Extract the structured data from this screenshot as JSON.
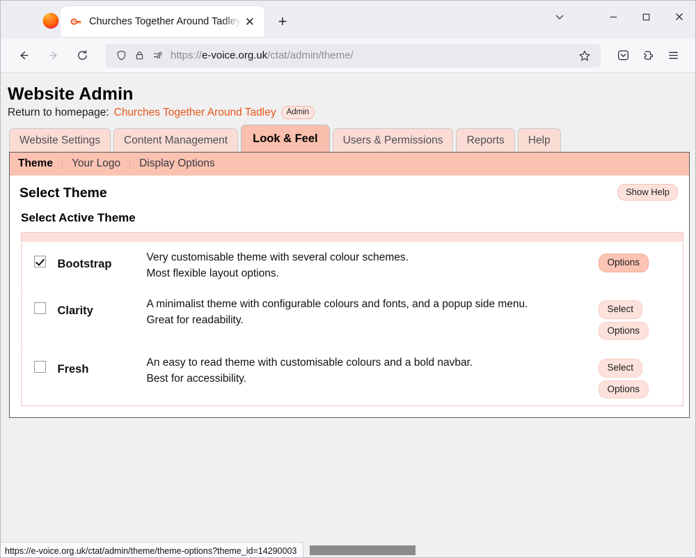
{
  "browser": {
    "tab": {
      "title": "Churches Together Around Tadley",
      "favicon_name": "key-icon",
      "close_label": "✕"
    },
    "newtab_label": "+",
    "window_controls": {
      "list_all_tabs": "⌄",
      "minimize": "—",
      "maximize": "▢",
      "close": "✕"
    },
    "nav": {
      "back": "←",
      "forward": "→",
      "reload": "⟳"
    },
    "urlbar": {
      "scheme": "https://",
      "host": "e-voice.org.uk",
      "path": "/ctat/admin/theme/",
      "full_url": "https://e-voice.org.uk/ctat/admin/theme/",
      "shield_icon": "tracking-protection-shield-icon",
      "lock_icon": "padlock-icon",
      "permissions_icon": "site-permissions-icon",
      "bookmark_icon": "star-icon"
    },
    "toolbar_trailing": {
      "pocket": "save-to-pocket-icon",
      "extensions": "extensions-icon",
      "app_menu": "hamburger-menu-icon"
    },
    "statusbar": {
      "link_preview": "https://e-voice.org.uk/ctat/admin/theme/theme-options?theme_id=14290003"
    }
  },
  "page": {
    "title": "Website Admin",
    "return_label": "Return to homepage:",
    "site_link": "Churches Together Around Tadley",
    "role_badge": "Admin",
    "main_tabs": [
      {
        "label": "Website Settings",
        "active": false
      },
      {
        "label": "Content Management",
        "active": false
      },
      {
        "label": "Look & Feel",
        "active": true
      },
      {
        "label": "Users & Permissions",
        "active": false
      },
      {
        "label": "Reports",
        "active": false
      },
      {
        "label": "Help",
        "active": false
      }
    ],
    "sub_tabs": [
      {
        "label": "Theme",
        "active": true
      },
      {
        "label": "Your Logo",
        "active": false
      },
      {
        "label": "Display Options",
        "active": false
      }
    ],
    "panel": {
      "heading": "Select Theme",
      "show_help": "Show Help",
      "section_heading": "Select Active Theme",
      "themes": [
        {
          "name": "Bootstrap",
          "checked": true,
          "desc": "Very customisable theme with several colour schemes.",
          "tagline": "Most flexible layout options.",
          "select_label": null,
          "options_label": "Options",
          "options_hot": true
        },
        {
          "name": "Clarity",
          "checked": false,
          "desc": "A minimalist theme with configurable colours and fonts, and a popup side menu.",
          "tagline": "Great for readability.",
          "select_label": "Select",
          "options_label": "Options",
          "options_hot": false
        },
        {
          "name": "Fresh",
          "checked": false,
          "desc": "An easy to read theme with customisable colours and a bold navbar.",
          "tagline": "Best for accessibility.",
          "select_label": "Select",
          "options_label": "Options",
          "options_hot": false
        }
      ]
    }
  },
  "colors": {
    "accent_orange": "#e8561d",
    "tab_active": "#fbbfae",
    "tab_inactive": "#fbdcd4",
    "subnav": "#fbc2b2",
    "pill": "#fde2dc",
    "pill_hot": "#fbc4b4",
    "table_header": "#fbdfdb"
  }
}
